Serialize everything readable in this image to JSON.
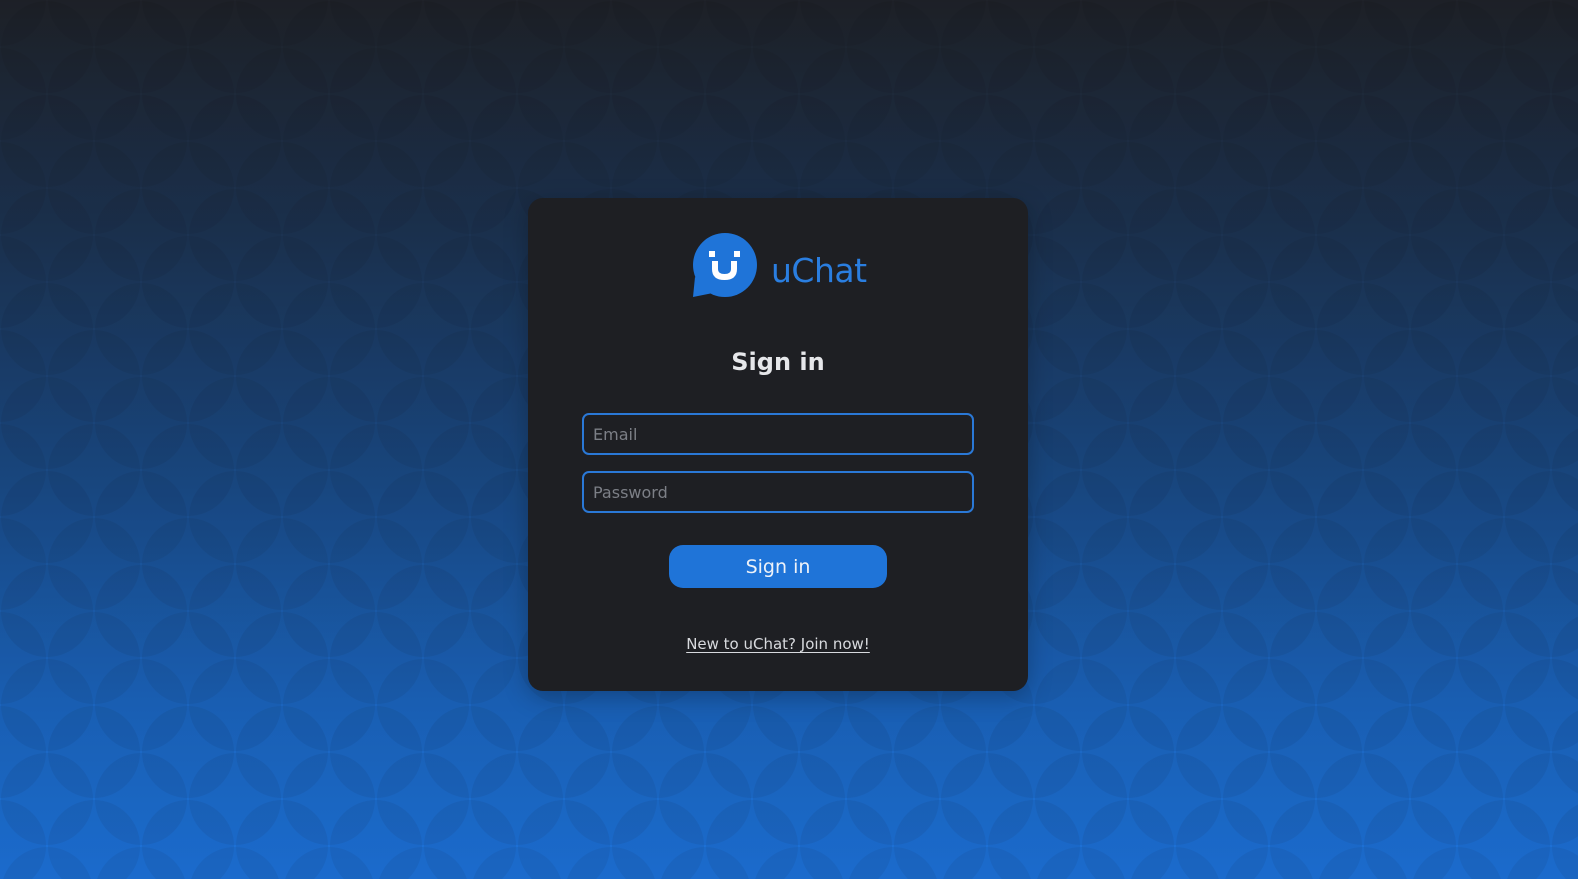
{
  "app": {
    "name": "uChat",
    "logo_letter": "U",
    "accent_color": "#1f74d8"
  },
  "form": {
    "heading": "Sign in",
    "email_placeholder": "Email",
    "password_placeholder": "Password",
    "submit_label": "Sign in",
    "join_link": "New to uChat? Join now!"
  }
}
